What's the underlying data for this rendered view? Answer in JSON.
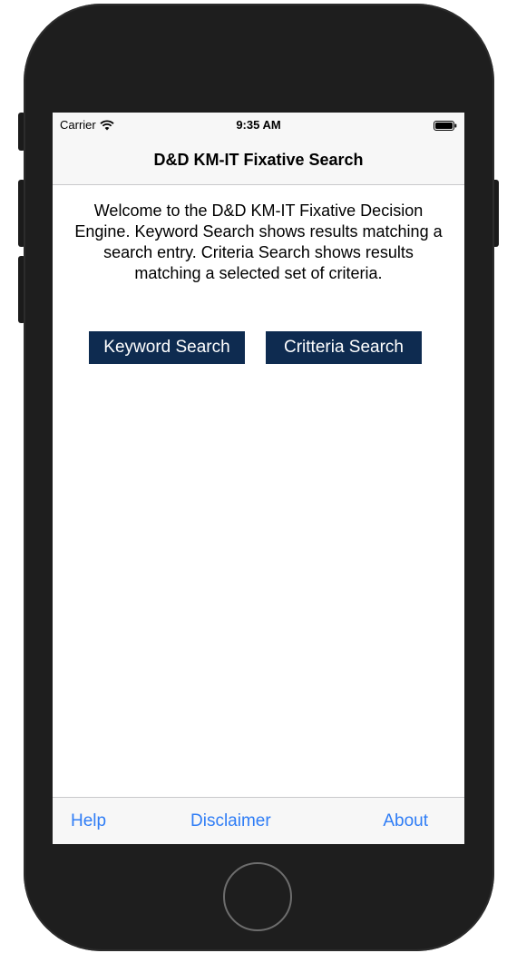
{
  "status_bar": {
    "carrier": "Carrier",
    "time": "9:35 AM",
    "wifi_icon": "wifi-icon",
    "battery_icon": "battery-icon"
  },
  "nav": {
    "title": "D&D KM-IT Fixative Search"
  },
  "main": {
    "welcome_text": "Welcome to the D&D KM-IT Fixative Decision Engine. Keyword Search shows results matching a search entry. Criteria Search shows results matching a selected set of criteria.",
    "keyword_button_label": "Keyword Search",
    "criteria_button_label": "Critteria Search"
  },
  "tab_bar": {
    "help_label": "Help",
    "disclaimer_label": "Disclaimer",
    "about_label": "About"
  },
  "colors": {
    "button_bg": "#0e2b50",
    "tab_tint": "#2f7df6",
    "bar_bg": "#f7f7f7",
    "device_frame": "#1e1e1e"
  }
}
